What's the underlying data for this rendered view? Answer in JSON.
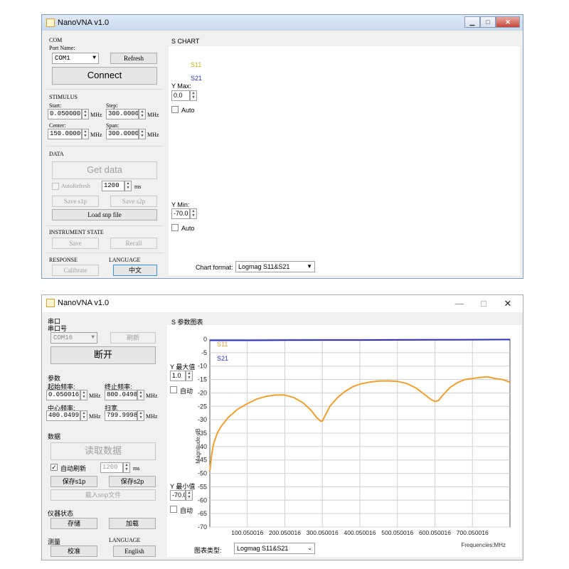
{
  "win1": {
    "title": "NanoVNA v1.0",
    "com": {
      "group": "COM",
      "port_label": "Port Name:",
      "port_value": "COM1",
      "refresh": "Refresh",
      "connect": "Connect"
    },
    "stimulus": {
      "group": "STIMULUS",
      "start_label": "Start:",
      "start_value": "0.050000",
      "step_label": "Step:",
      "step_value": "300.000000",
      "center_label": "Center:",
      "center_value": "150.000000",
      "span_label": "Span:",
      "span_value": "300.000000",
      "unit": "MHz"
    },
    "data": {
      "group": "DATA",
      "get_data": "Get data",
      "auto_refresh": "AutoRefresh",
      "interval": "1200",
      "interval_unit": "ms",
      "save_s1p": "Save s1p",
      "save_s2p": "Save s2p",
      "load_snp": "Load snp file"
    },
    "instrument": {
      "group": "INSTRUMENT STATE",
      "save": "Save",
      "recall": "Recall"
    },
    "response": {
      "group": "RESPONSE",
      "calibrate": "Calibrate"
    },
    "language": {
      "group": "LANGUAGE",
      "button": "中文"
    },
    "chart": {
      "group": "S CHART",
      "legend_s11": "S11",
      "legend_s21": "S21",
      "ymax_label": "Y Max:",
      "ymax_value": "0.0",
      "auto1": "Auto",
      "ymin_label": "Y Min:",
      "ymin_value": "-70.0",
      "auto2": "Auto",
      "format_label": "Chart format:",
      "format_value": "Logmag S11&S21"
    }
  },
  "win2": {
    "title": "NanoVNA v1.0",
    "com": {
      "group": "串口",
      "port_label": "串口号",
      "port_value": "COM16",
      "refresh": "刷新",
      "connect": "断开"
    },
    "stimulus": {
      "group": "参数",
      "start_label": "起始频率:",
      "start_value": "0.050016",
      "step_label": "终止频率:",
      "step_value": "800.049816",
      "center_label": "中心频率:",
      "center_value": "400.049916",
      "span_label": "扫宽",
      "span_value": "799.999800",
      "unit": "MHz"
    },
    "data": {
      "group": "数据",
      "get_data": "读取数据",
      "auto_refresh": "自动刷新",
      "interval": "1200",
      "interval_unit": "ms",
      "save_s1p": "保存s1p",
      "save_s2p": "保存s2p",
      "load_snp": "载入snp文件"
    },
    "instrument": {
      "group": "仪器状态",
      "save": "存储",
      "recall": "加载"
    },
    "response": {
      "group": "测量",
      "calibrate": "校准"
    },
    "language": {
      "group": "LANGUAGE",
      "button": "English"
    },
    "chart": {
      "group": "S 参数图表",
      "legend_s11": "S11",
      "legend_s21": "S21",
      "ymax_label": "Y 最大值",
      "ymax_value": "1.0",
      "auto1": "自动",
      "ymin_label": "Y 最小值",
      "ymin_value": "-70.0",
      "auto2": "自动",
      "format_label": "图表类型:",
      "format_value": "Logmag S11&S21",
      "ylabel": "Magnitude:dB",
      "xlabel": "Frequencies:MHz"
    }
  },
  "colors": {
    "s11": "#f0a030",
    "s21": "#3030c0",
    "s11_legend": "#c8b020"
  },
  "chart_data": {
    "type": "line",
    "xlabel": "Frequencies:MHz",
    "ylabel": "Magnitude:dB",
    "ylim": [
      -70,
      0
    ],
    "xlim": [
      0.050016,
      800.049816
    ],
    "grid": true,
    "legend": "top-left",
    "y_ticks": [
      0,
      -5,
      -10,
      -15,
      -20,
      -25,
      -30,
      -35,
      -40,
      -45,
      -50,
      -55,
      -60,
      -65,
      -70
    ],
    "x_ticks": [
      100.050016,
      200.050016,
      300.050016,
      400.050016,
      500.050016,
      600.050016,
      700.050016
    ],
    "x_tick_labels": [
      "100.050016",
      "200.050016",
      "300.050016",
      "400.050016",
      "500.050016",
      "600.050016",
      "700.050016"
    ],
    "series": [
      {
        "name": "S11",
        "color": "#f0a030",
        "x": [
          0.05,
          5,
          10,
          20,
          30,
          50,
          75,
          100,
          125,
          150,
          175,
          200,
          225,
          250,
          270,
          285,
          295,
          300,
          310,
          320,
          340,
          360,
          380,
          400,
          425,
          450,
          475,
          500,
          525,
          550,
          570,
          590,
          600,
          610,
          620,
          640,
          660,
          680,
          700,
          720,
          740,
          760,
          780,
          800
        ],
        "y": [
          -49,
          -43,
          -39,
          -35,
          -32.5,
          -29,
          -26,
          -24,
          -22.3,
          -21.3,
          -20.8,
          -20.8,
          -21.8,
          -23.8,
          -26.5,
          -29.2,
          -30.5,
          -30.5,
          -27.8,
          -25,
          -21.8,
          -19.5,
          -17.8,
          -16.7,
          -16,
          -15.6,
          -15.5,
          -15.7,
          -16.5,
          -18.2,
          -20.3,
          -22.5,
          -23.2,
          -22.8,
          -21,
          -18,
          -16.2,
          -15,
          -14.6,
          -14.2,
          -14,
          -14.6,
          -15,
          -16
        ]
      },
      {
        "name": "S21",
        "color": "#3030c0",
        "x": [
          0.05,
          100,
          200,
          300,
          400,
          500,
          600,
          700,
          800
        ],
        "y": [
          -0.4,
          -0.4,
          -0.35,
          -0.3,
          -0.3,
          -0.25,
          -0.2,
          -0.15,
          -0.1
        ]
      }
    ]
  }
}
